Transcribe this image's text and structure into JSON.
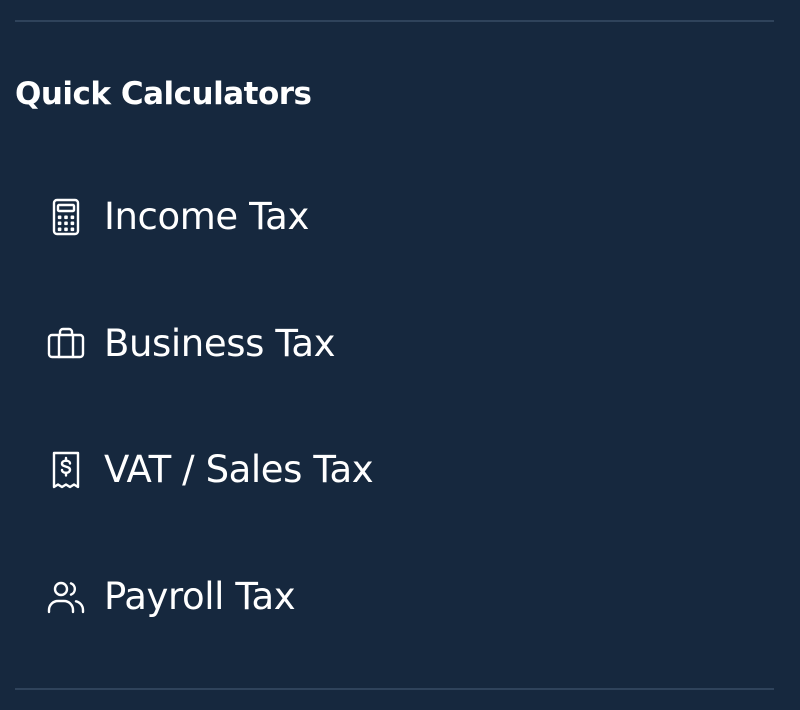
{
  "sidebar": {
    "section_title": "Quick Calculators",
    "items": [
      {
        "label": "Income Tax",
        "icon": "calculator-icon"
      },
      {
        "label": "Business Tax",
        "icon": "briefcase-icon"
      },
      {
        "label": "VAT / Sales Tax",
        "icon": "receipt-dollar-icon"
      },
      {
        "label": "Payroll Tax",
        "icon": "users-icon"
      }
    ]
  },
  "colors": {
    "background": "#16283e",
    "divider": "#2f435b",
    "text": "#ffffff"
  }
}
